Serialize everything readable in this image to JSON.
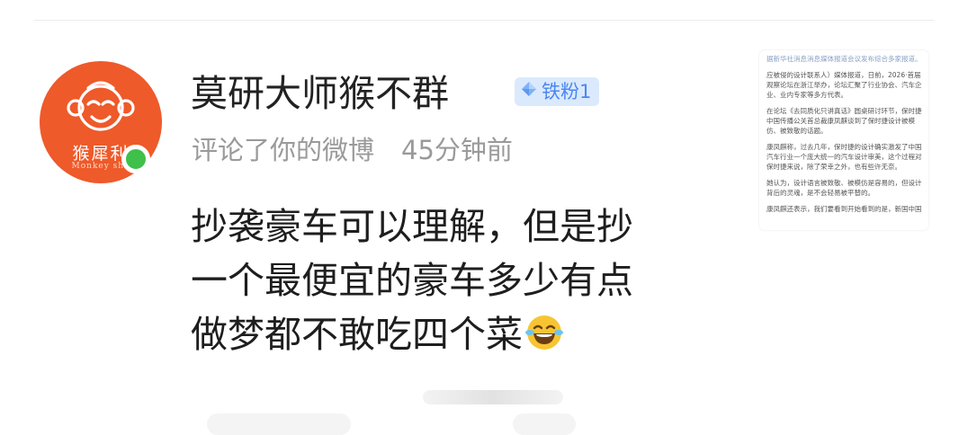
{
  "user": {
    "name": "莫研大师猴不群",
    "badge_label": "铁粉1",
    "avatar_brand": "猴犀利",
    "avatar_sub": "Monkey sha"
  },
  "meta": {
    "action": "评论了你的微博",
    "time": "45分钟前"
  },
  "comment": {
    "lines": [
      "抄袭豪车可以理解，但是抄",
      "一个最便宜的豪车多少有点",
      "做梦都不敢吃四个菜"
    ],
    "emoji": "joy-tears-emoji"
  },
  "thumbnail": {
    "paragraphs": [
      "据新华社消息消息媒体报道会议发布综合多家报道。",
      "应被侵的设计联系人）媒体报道，日前，2026·首届观察论坛在浙江举办，论坛汇聚了行业协会、汽车企业、业内专家等多方代表。",
      "在论坛《去同质化只讲真话》圆桌研讨环节，保时捷中国传播公关首总裁康凤麒谈到了保时捷设计被模仿、被致敬的话题。",
      "康凤麒称，过去几年，保时捷的设计确实激发了中国汽车行业一个庞大统一的汽车设计审美，这个过程对保时捷来说，除了荣幸之外，也有些许无奈。",
      "她认为，设计语言被致敬、被模仿是容易的，但设计背后的灵魂，是不会轻易被平替的。",
      "康凤麒还表示，我们要看到开始看到的是，新国中国"
    ]
  },
  "colors": {
    "avatar_bg": "#ee5a2a",
    "online": "#3ec04a",
    "badge_bg": "#dbe9fd",
    "badge_text": "#4a87f0",
    "meta_text": "#9a9a9a"
  }
}
